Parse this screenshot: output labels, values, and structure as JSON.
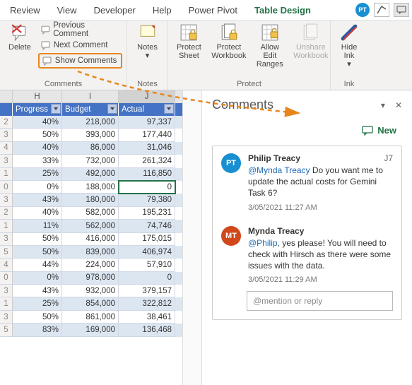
{
  "tabs": {
    "review": "Review",
    "view": "View",
    "developer": "Developer",
    "help": "Help",
    "powerpivot": "Power Pivot",
    "tabledesign": "Table Design"
  },
  "avatar": "PT",
  "ribbon": {
    "delete": "Delete",
    "prev": "Previous Comment",
    "next": "Next Comment",
    "show": "Show Comments",
    "comments_label": "Comments",
    "notes": "Notes",
    "notes_label": "Notes",
    "protect_sheet": "Protect Sheet",
    "protect_wb": "Protect Workbook",
    "allow_edit": "Allow Edit Ranges",
    "unshare": "Unshare Workbook",
    "protect_label": "Protect",
    "hide_ink": "Hide Ink",
    "ink_label": "Ink"
  },
  "grid": {
    "cols": {
      "h": "H",
      "i": "I",
      "j": "J"
    },
    "headers": {
      "progress": "Progress",
      "budget": "Budget",
      "actual": "Actual"
    },
    "rows": [
      {
        "n": 2,
        "p": "40%",
        "b": "218,000",
        "a": "97,337"
      },
      {
        "n": 3,
        "p": "50%",
        "b": "393,000",
        "a": "177,440"
      },
      {
        "n": 4,
        "p": "40%",
        "b": "86,000",
        "a": "31,046"
      },
      {
        "n": 3,
        "p": "33%",
        "b": "732,000",
        "a": "261,324"
      },
      {
        "n": 1,
        "p": "25%",
        "b": "492,000",
        "a": "116,850"
      },
      {
        "n": 0,
        "p": "0%",
        "b": "188,000",
        "a": "0",
        "sel": true
      },
      {
        "n": 3,
        "p": "43%",
        "b": "180,000",
        "a": "79,380"
      },
      {
        "n": 2,
        "p": "40%",
        "b": "582,000",
        "a": "195,231"
      },
      {
        "n": 1,
        "p": "11%",
        "b": "562,000",
        "a": "74,746"
      },
      {
        "n": 3,
        "p": "50%",
        "b": "416,000",
        "a": "175,015"
      },
      {
        "n": 5,
        "p": "50%",
        "b": "839,000",
        "a": "406,974"
      },
      {
        "n": 4,
        "p": "44%",
        "b": "224,000",
        "a": "57,910"
      },
      {
        "n": 0,
        "p": "0%",
        "b": "978,000",
        "a": "0"
      },
      {
        "n": 3,
        "p": "43%",
        "b": "932,000",
        "a": "379,157"
      },
      {
        "n": 1,
        "p": "25%",
        "b": "854,000",
        "a": "322,812"
      },
      {
        "n": 3,
        "p": "50%",
        "b": "861,000",
        "a": "38,461"
      },
      {
        "n": 5,
        "p": "83%",
        "b": "169,000",
        "a": "136,468"
      }
    ]
  },
  "pane": {
    "title": "Comments",
    "new": "New",
    "comments": [
      {
        "initials": "PT",
        "cls": "pt",
        "name": "Philip Treacy",
        "ref": "J7",
        "mention": "@Mynda Treacy",
        "text": " Do you want me to update the actual costs for Gemini Task 6?",
        "time": "3/05/2021 11:27 AM"
      },
      {
        "initials": "MT",
        "cls": "mt",
        "name": "Mynda Treacy",
        "ref": "",
        "mention": "@Philip",
        "text": ", yes please! You will need to check with Hirsch as there were some issues with the data.",
        "time": "3/05/2021 11:29 AM"
      }
    ],
    "reply_placeholder": "@mention or reply"
  }
}
